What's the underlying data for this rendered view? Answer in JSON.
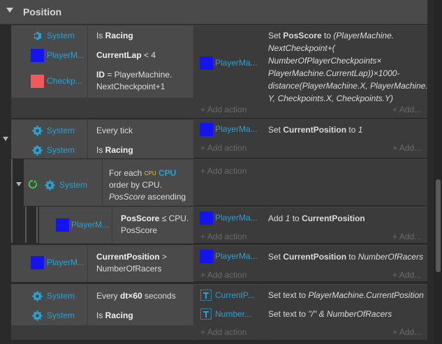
{
  "group": {
    "title": "Position"
  },
  "colors": {
    "blue_obj": "#1414f0",
    "red_obj": "#f05a5a",
    "link": "#27a3d4",
    "gear": "#27a3d4"
  },
  "labels": {
    "add_action": "Add action",
    "add_more": "Add..."
  },
  "ev1": {
    "c1_obj": "System",
    "c1_pre": "Is ",
    "c1_bold": "Racing",
    "c2_obj": "PlayerM...",
    "c2_bold": "CurrentLap",
    "c2_rest": " < 4",
    "c3_obj": "Checkp...",
    "c3_bold": "ID",
    "c3_rest": " = PlayerMachine.",
    "c3_line2": "NextCheckpoint+1",
    "a1_obj": "PlayerMa...",
    "a1_l1_pre": "Set ",
    "a1_l1_bold": "PosScore",
    "a1_l1_mid": " to ",
    "a1_l1_it": "(PlayerMachine.",
    "a1_l2": "NextCheckpoint+(",
    "a1_l3": "NumberOfPlayerCheckpoints×",
    "a1_l4": "PlayerMachine.CurrentLap))×1000-",
    "a1_l5": "distance(PlayerMachine.X, PlayerMachine.",
    "a1_l6": "Y, Checkpoints.X, Checkpoints.Y)"
  },
  "ev2": {
    "c1_obj": "System",
    "c1_text": "Every tick",
    "c2_obj": "System",
    "c2_pre": "Is ",
    "c2_bold": "Racing",
    "a1_obj": "PlayerMa...",
    "a1_pre": "Set ",
    "a1_bold": "CurrentPosition",
    "a1_mid": " to ",
    "a1_it": "1"
  },
  "ev3": {
    "c1_obj": "System",
    "c1_pre": "For each ",
    "c1_badge": "CPU",
    "c1_bold": "CPU",
    "c1_line2": "order by CPU.",
    "c1_line3_it": "PosScore",
    "c1_line3": " ascending"
  },
  "ev4": {
    "c1_obj": "PlayerM...",
    "c1_bold": "PosScore",
    "c1_rest": " ≤ CPU.",
    "c1_line2": "PosScore",
    "a1_obj": "PlayerMa...",
    "a1_pre": "Add ",
    "a1_it": "1",
    "a1_mid": " to ",
    "a1_bold": "CurrentPosition"
  },
  "ev5": {
    "c1_obj": "PlayerM...",
    "c1_bold": "CurrentPosition",
    "c1_rest": " >",
    "c1_line2": "NumberOfRacers",
    "a1_obj": "PlayerMa...",
    "a1_pre": "Set ",
    "a1_bold": "CurrentPosition",
    "a1_mid": " to ",
    "a1_it": "NumberOfRacers"
  },
  "ev6": {
    "c1_obj": "System",
    "c1_pre": "Every ",
    "c1_bold": "dt×60",
    "c1_rest": " seconds",
    "c2_obj": "System",
    "c2_pre": "Is ",
    "c2_bold": "Racing",
    "a1_obj": "CurrentP...",
    "a1_pre": "Set text to ",
    "a1_it": "PlayerMachine.CurrentPosition",
    "a2_obj": "Number...",
    "a2_pre": "Set text to ",
    "a2_it": "\"/\" & NumberOfRacers"
  }
}
